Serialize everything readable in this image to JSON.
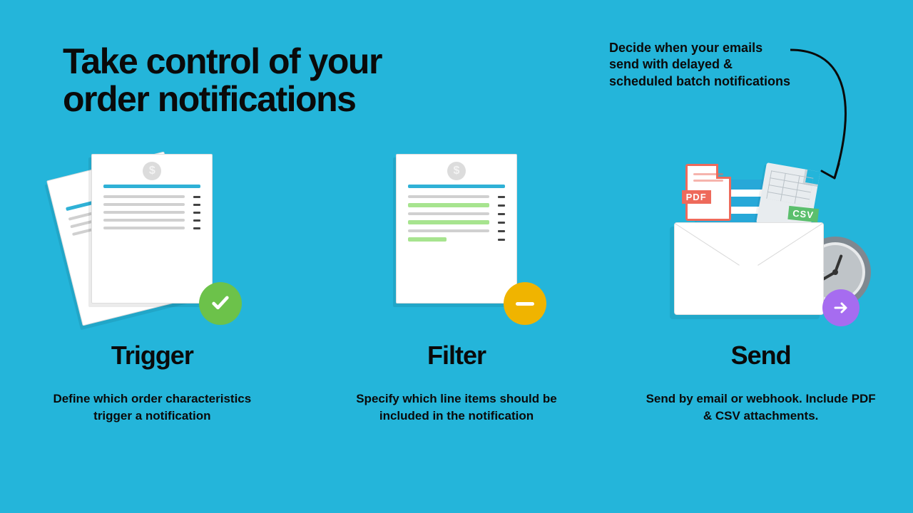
{
  "headline": "Take control of your\norder notifications",
  "callout": "Decide when your emails send with delayed & scheduled batch notifications",
  "columns": [
    {
      "title": "Trigger",
      "desc": "Define which order characteristics trigger a notification"
    },
    {
      "title": "Filter",
      "desc": "Specify which line items should be included in the notification"
    },
    {
      "title": "Send",
      "desc": "Send by email or webhook. Include PDF & CSV attachments."
    }
  ],
  "attachments": {
    "pdf_label": "PDF",
    "csv_label": "CSV"
  },
  "colors": {
    "bg": "#24b5da",
    "accent_green": "#6cc24a",
    "accent_yellow": "#f0b400",
    "accent_purple": "#a66cf0"
  }
}
